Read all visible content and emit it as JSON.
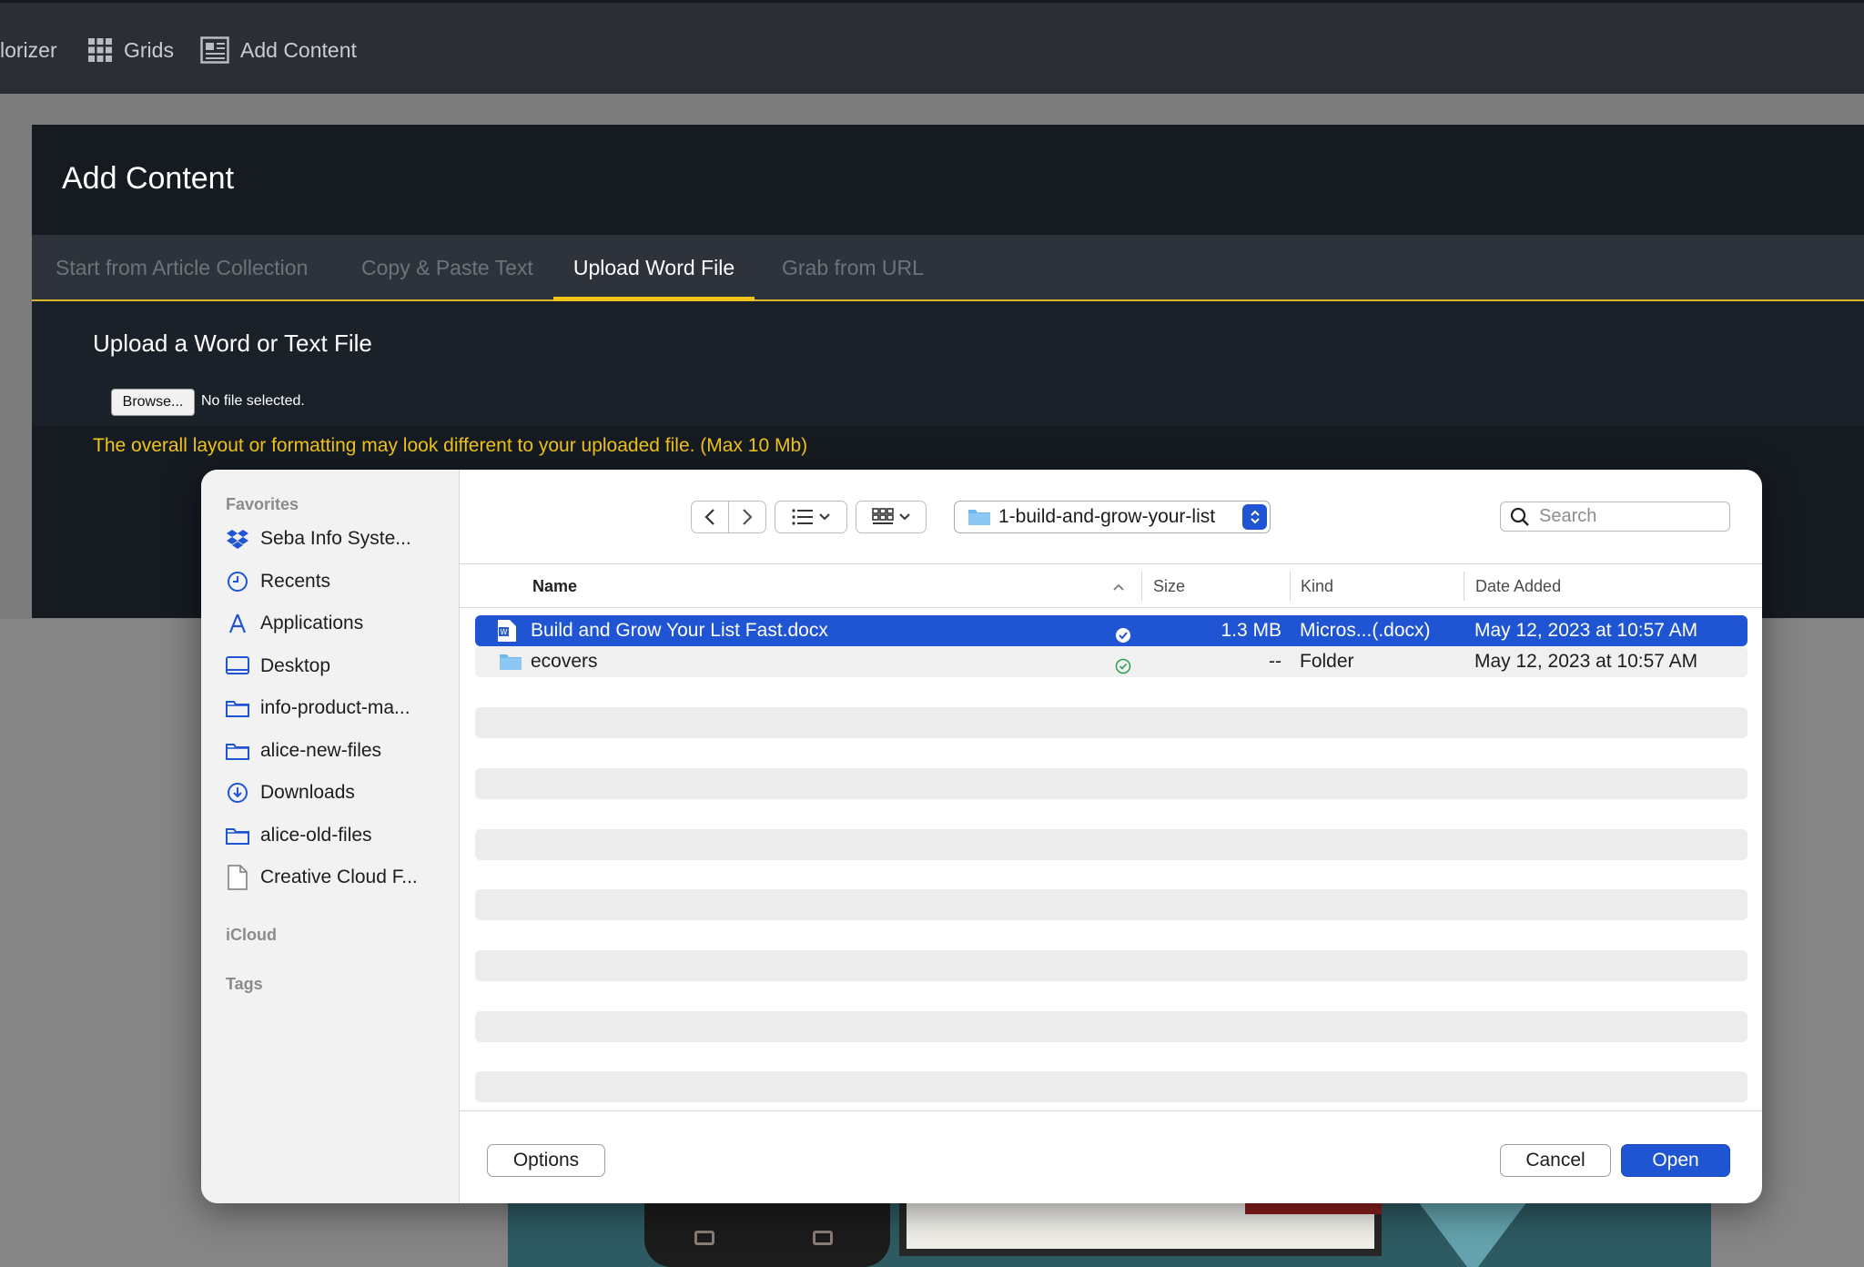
{
  "topbar": {
    "items": [
      {
        "label": "lorizer",
        "icon": "none"
      },
      {
        "label": "Grids",
        "icon": "grid-icon"
      },
      {
        "label": "Add Content",
        "icon": "article-icon"
      }
    ]
  },
  "modal": {
    "title": "Add Content",
    "tabs": [
      {
        "label": "Start from Article Collection",
        "active": false
      },
      {
        "label": "Copy & Paste Text",
        "active": false
      },
      {
        "label": "Upload Word File",
        "active": true
      },
      {
        "label": "Grab from URL",
        "active": false
      }
    ],
    "upload_title": "Upload a Word or Text File",
    "browse_label": "Browse...",
    "no_file_text": "No file selected.",
    "warning": "The overall layout or formatting may look different to your uploaded file. (Max 10 Mb)",
    "accent_color": "#f0c419"
  },
  "dialog": {
    "sidebar": {
      "favorites_heading": "Favorites",
      "favorites": [
        {
          "label": "Seba Info Syste...",
          "icon": "dropbox-icon"
        },
        {
          "label": "Recents",
          "icon": "clock-icon"
        },
        {
          "label": "Applications",
          "icon": "applications-icon"
        },
        {
          "label": "Desktop",
          "icon": "desktop-icon"
        },
        {
          "label": "info-product-ma...",
          "icon": "folder-icon"
        },
        {
          "label": "alice-new-files",
          "icon": "folder-icon"
        },
        {
          "label": "Downloads",
          "icon": "download-icon"
        },
        {
          "label": "alice-old-files",
          "icon": "folder-icon"
        },
        {
          "label": "Creative Cloud F...",
          "icon": "document-icon"
        }
      ],
      "icloud_heading": "iCloud",
      "tags_heading": "Tags"
    },
    "path_label": "1-build-and-grow-your-list",
    "search_placeholder": "Search",
    "columns": {
      "name": "Name",
      "size": "Size",
      "kind": "Kind",
      "date": "Date Added"
    },
    "files": [
      {
        "name": "Build and Grow Your List Fast.docx",
        "icon": "word-doc-icon",
        "size": "1.3 MB",
        "kind": "Micros...(.docx)",
        "date": "May 12, 2023 at 10:57 AM",
        "selected": true
      },
      {
        "name": "ecovers",
        "icon": "folder-icon",
        "size": "--",
        "kind": "Folder",
        "date": "May 12, 2023 at 10:57 AM",
        "selected": false
      }
    ],
    "options_label": "Options",
    "cancel_label": "Cancel",
    "open_label": "Open",
    "selection_color": "#1f55d2"
  }
}
